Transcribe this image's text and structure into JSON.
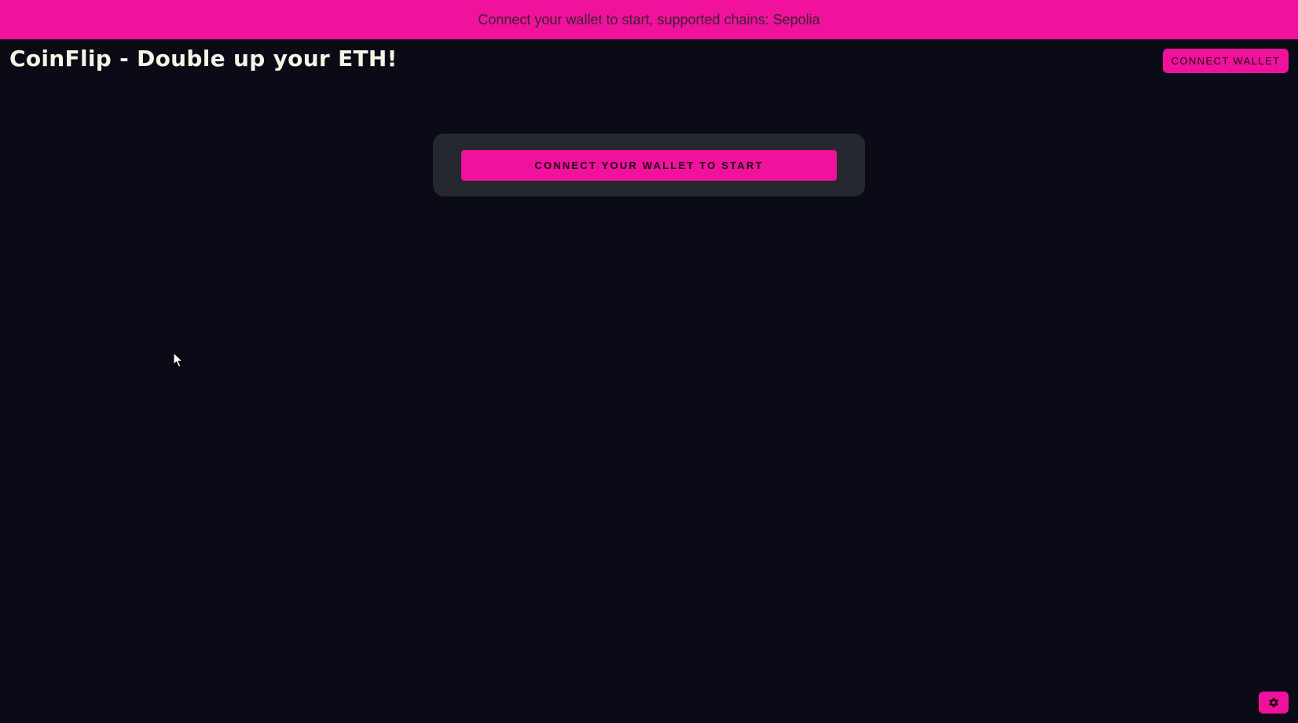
{
  "banner": {
    "text": "Connect your wallet to start, supported chains: Sepolia"
  },
  "header": {
    "title": "CoinFlip - Double up your ETH!",
    "connect_label": "CONNECT WALLET"
  },
  "card": {
    "connect_label": "CONNECT YOUR WALLET TO START"
  },
  "icons": {
    "cursor": "mouse-pointer-icon",
    "settings": "gear-icon"
  },
  "colors": {
    "accent": "#f0129c",
    "background": "#0b0b17",
    "card": "#26282f",
    "title": "#f3f6e4"
  }
}
